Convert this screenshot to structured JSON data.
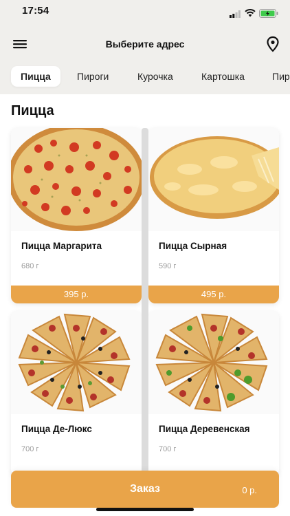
{
  "status_bar": {
    "time": "17:54"
  },
  "header": {
    "title": "Выберите адрес"
  },
  "tabs": [
    {
      "label": "Пицца",
      "active": true
    },
    {
      "label": "Пироги"
    },
    {
      "label": "Курочка"
    },
    {
      "label": "Картошка"
    },
    {
      "label": "Пир"
    }
  ],
  "section": {
    "title": "Пицца"
  },
  "products": [
    {
      "name": "Пицца Маргарита",
      "weight": "680 г",
      "price": "395 р.",
      "image": "pizza-margherita-icon"
    },
    {
      "name": "Пицца Сырная",
      "weight": "590 г",
      "price": "495 р.",
      "image": "pizza-cheese-icon"
    },
    {
      "name": "Пицца Де-Люкс",
      "weight": "700 г",
      "price": "",
      "image": "pizza-deluxe-icon"
    },
    {
      "name": "Пицца Деревенская",
      "weight": "700 г",
      "price": "",
      "image": "pizza-village-icon"
    }
  ],
  "order": {
    "label": "Заказ",
    "total": "0 р."
  },
  "colors": {
    "accent": "#e9a449",
    "topbar": "#f0efec"
  }
}
